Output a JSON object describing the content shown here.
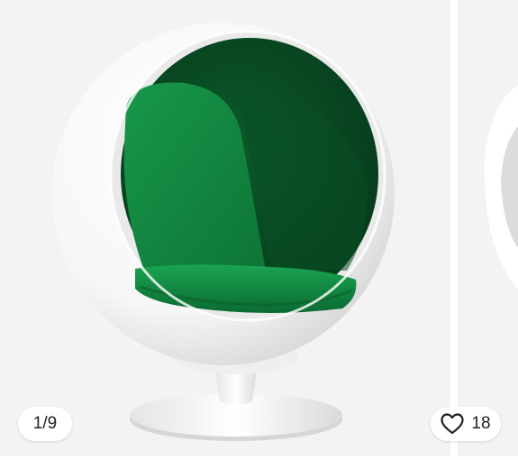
{
  "gallery": {
    "counter_text": "1/9",
    "favorite_count": "18",
    "icons": {
      "favorite": "heart-icon"
    }
  },
  "product_image": {
    "subject": "ball-chair-image",
    "colors": {
      "shell": "#ffffff",
      "upholstery": "#0f7a3c",
      "background": "#f3f3f3"
    }
  }
}
